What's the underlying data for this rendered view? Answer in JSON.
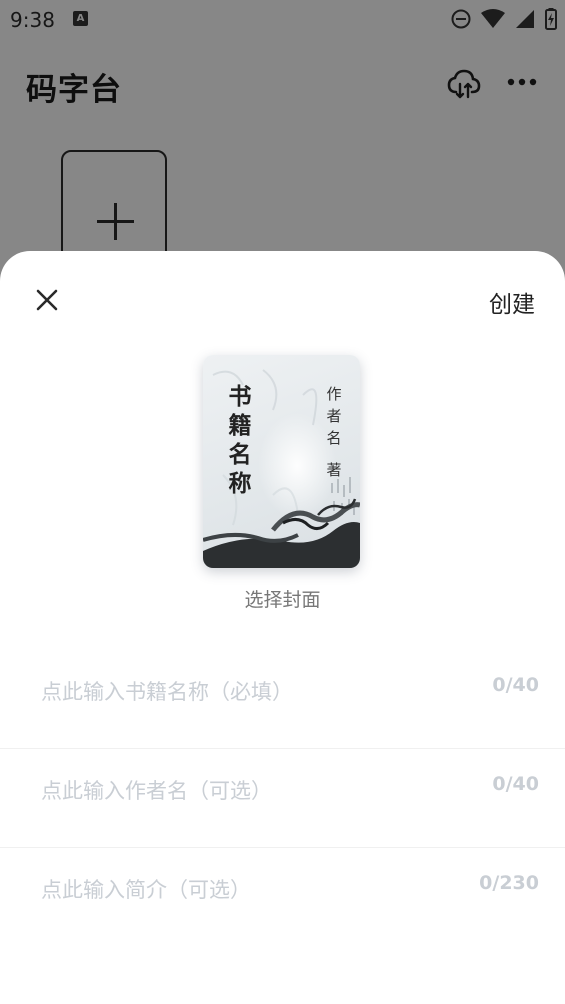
{
  "status_bar": {
    "time": "9:38",
    "notification_badge": "A",
    "icons": [
      "do-not-disturb-icon",
      "wifi-icon",
      "signal-icon",
      "battery-charging-icon"
    ]
  },
  "app": {
    "title": "码字台",
    "icons": [
      "cloud-sync-icon",
      "more-icon",
      "plus-icon"
    ]
  },
  "sheet": {
    "close_icon": "close-icon",
    "create_label": "创建",
    "cover": {
      "title": "书籍名称",
      "author": "作者名",
      "suffix": "著",
      "select_label": "选择封面"
    },
    "fields": {
      "name": {
        "placeholder": "点此输入书籍名称（必填）",
        "counter": "0/40"
      },
      "author": {
        "placeholder": "点此输入作者名（可选）",
        "counter": "0/40"
      },
      "intro": {
        "placeholder": "点此输入简介（可选）",
        "counter": "0/230"
      }
    }
  },
  "colors": {
    "overlay": "#000000",
    "sheet_bg": "#ffffff",
    "placeholder": "#c9ced4",
    "title_text": "#1a1a1a"
  }
}
